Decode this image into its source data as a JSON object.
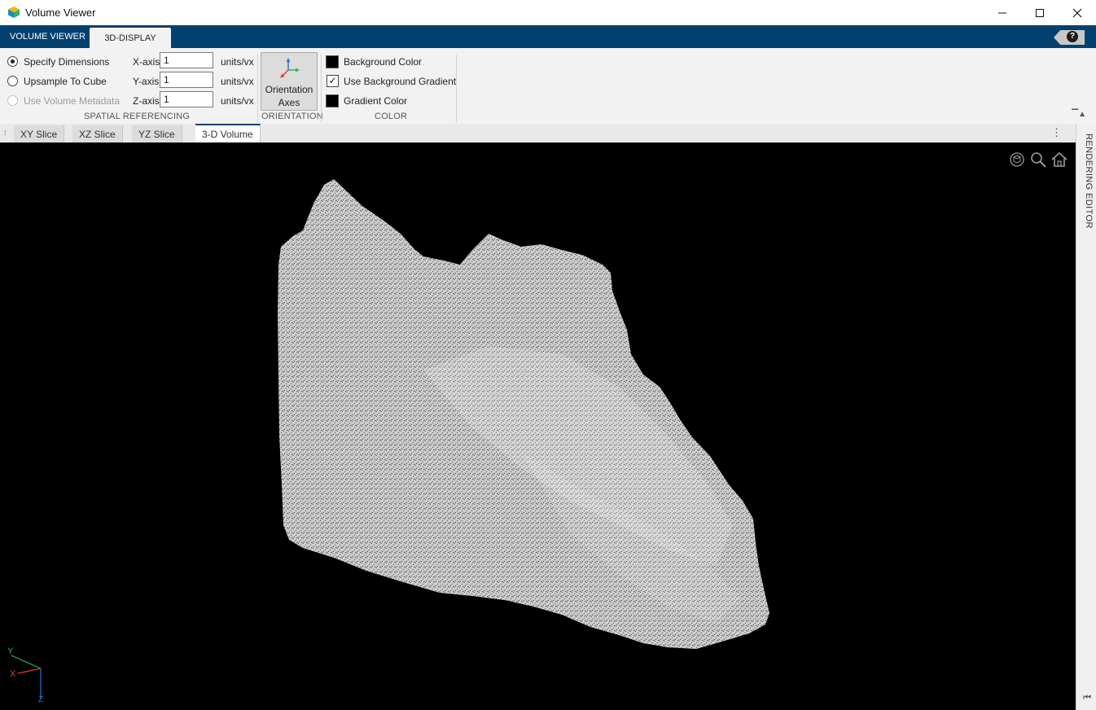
{
  "window": {
    "title": "Volume Viewer",
    "controls": [
      "minimize-icon",
      "maximize-icon",
      "close-icon"
    ]
  },
  "ribbon": {
    "tabs": [
      {
        "label": "VOLUME VIEWER",
        "active": false
      },
      {
        "label": "3D-DISPLAY",
        "active": true
      }
    ],
    "help_label": "?"
  },
  "toolstrip": {
    "spatial_referencing": {
      "section_label": "SPATIAL REFERENCING",
      "options": [
        {
          "label": "Specify Dimensions",
          "selected": true,
          "enabled": true
        },
        {
          "label": "Upsample To Cube",
          "selected": false,
          "enabled": true
        },
        {
          "label": "Use Volume Metadata",
          "selected": false,
          "enabled": false
        }
      ],
      "axes": [
        {
          "label": "X-axis",
          "value": "1",
          "unit": "units/vx"
        },
        {
          "label": "Y-axis",
          "value": "1",
          "unit": "units/vx"
        },
        {
          "label": "Z-axis",
          "value": "1",
          "unit": "units/vx"
        }
      ]
    },
    "orientation": {
      "section_label": "ORIENTATION",
      "button_line1": "Orientation",
      "button_line2": "Axes"
    },
    "color": {
      "section_label": "COLOR",
      "background_color_label": "Background Color",
      "use_gradient_label": "Use Background Gradient",
      "use_gradient_checked": true,
      "gradient_color_label": "Gradient Color",
      "background_color": "#000000",
      "gradient_color": "#000000"
    }
  },
  "document_tabs": [
    {
      "label": "XY Slice",
      "active": false
    },
    {
      "label": "XZ Slice",
      "active": false
    },
    {
      "label": "YZ Slice",
      "active": false
    },
    {
      "label": "3-D Volume",
      "active": true
    }
  ],
  "viewport": {
    "toolbar_icons": [
      "rotate-3d-icon",
      "zoom-icon",
      "home-icon"
    ],
    "axes_indicator": {
      "x": "X",
      "y": "Y",
      "z": "Z"
    }
  },
  "side_panel": {
    "label": "RENDERING EDITOR"
  },
  "colors": {
    "ribbon_blue": "#02416f",
    "toolstrip_bg": "#f2f2f2",
    "axis_x": "#e03c3c",
    "axis_y": "#33b24a",
    "axis_z": "#2f6fd6"
  }
}
